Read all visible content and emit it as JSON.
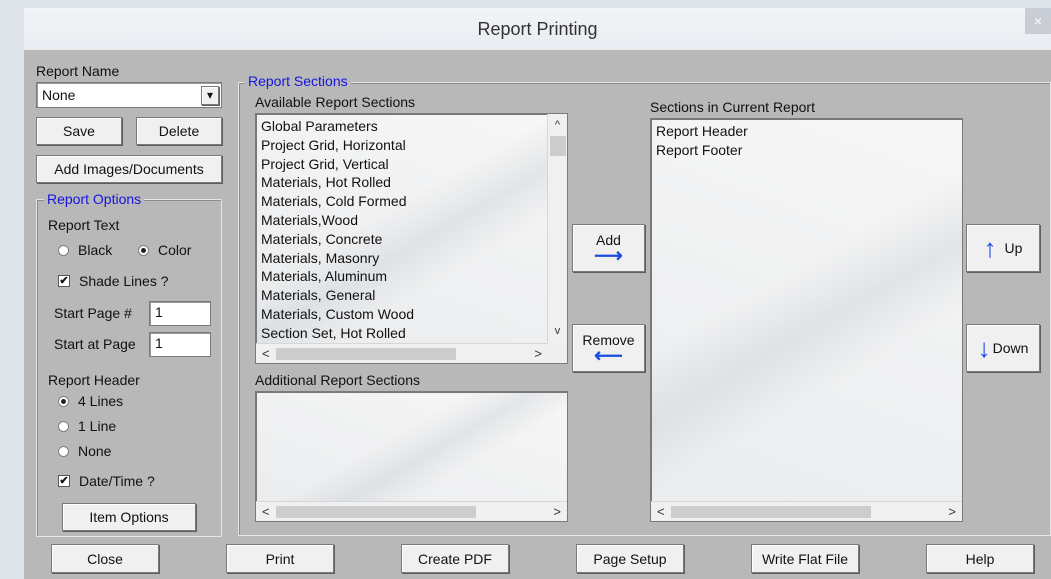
{
  "window": {
    "title": "Report Printing",
    "close_glyph": "×"
  },
  "report_name": {
    "label": "Report Name",
    "value": "None",
    "arrow": "▾"
  },
  "buttons": {
    "save": "Save",
    "delete": "Delete",
    "add_images": "Add Images/Documents",
    "item_options": "Item Options",
    "add": "Add",
    "remove": "Remove",
    "up": "Up",
    "down": "Down",
    "close": "Close",
    "print": "Print",
    "create_pdf": "Create PDF",
    "page_setup": "Page Setup",
    "write_flat_file": "Write Flat File",
    "help": "Help"
  },
  "report_options": {
    "title": "Report Options",
    "report_text_label": "Report Text",
    "black_label": "Black",
    "color_label": "Color",
    "selected_text": "Color",
    "shade_lines_label": "Shade Lines ?",
    "shade_lines_checked": true,
    "start_page_label": "Start Page #",
    "start_page_value": "1",
    "start_at_page_label": "Start at Page",
    "start_at_page_value": "1",
    "report_header_label": "Report Header",
    "header_4_lines": "4 Lines",
    "header_1_line": "1 Line",
    "header_none": "None",
    "selected_header": "4 Lines",
    "date_time_label": "Date/Time ?",
    "date_time_checked": true,
    "check_glyph": "✔"
  },
  "report_sections": {
    "title": "Report Sections",
    "available_label": "Available Report Sections",
    "available": [
      "Global Parameters",
      "Project Grid, Horizontal",
      "Project Grid, Vertical",
      "Materials, Hot Rolled",
      "Materials, Cold Formed",
      "Materials,Wood",
      "Materials, Concrete",
      "Materials, Masonry",
      "Materials, Aluminum",
      "Materials, General",
      "Materials, Custom Wood",
      "Section Set, Hot Rolled"
    ],
    "additional_label": "Additional Report Sections",
    "current_label": "Sections in Current Report",
    "current": [
      "Report Header",
      "Report Footer"
    ]
  },
  "icons": {
    "arrow_right": "⟶",
    "arrow_left": "⟵",
    "arrow_up": "↑",
    "arrow_down": "↓",
    "scroll_left": "<",
    "scroll_right": ">",
    "scroll_up": "^",
    "scroll_down": "v"
  },
  "colors": {
    "accent_blue": "#1515e0",
    "dialog_bg": "#b8b8b8"
  }
}
